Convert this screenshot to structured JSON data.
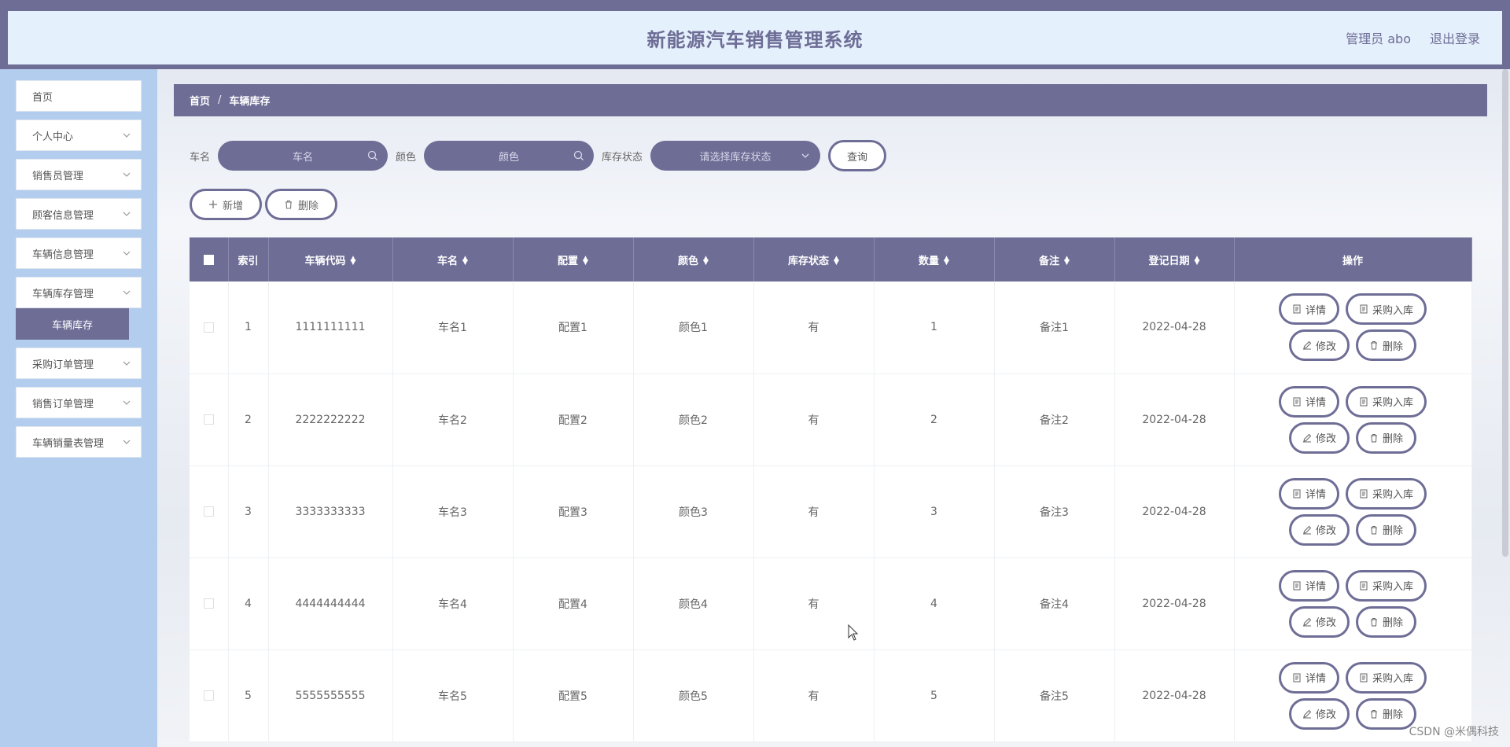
{
  "header": {
    "title": "新能源汽车销售管理系统",
    "user": "管理员 abo",
    "logout": "退出登录"
  },
  "sidebar": {
    "items": [
      {
        "label": "首页",
        "chevron": false
      },
      {
        "label": "个人中心",
        "chevron": true
      },
      {
        "label": "销售员管理",
        "chevron": true
      },
      {
        "label": "顾客信息管理",
        "chevron": true
      },
      {
        "label": "车辆信息管理",
        "chevron": true
      },
      {
        "label": "车辆库存管理",
        "chevron": true
      },
      {
        "label": "采购订单管理",
        "chevron": true
      },
      {
        "label": "销售订单管理",
        "chevron": true
      },
      {
        "label": "车辆销量表管理",
        "chevron": true
      }
    ],
    "active_sub": "车辆库存"
  },
  "breadcrumb": {
    "home": "首页",
    "sep": "/",
    "current": "车辆库存"
  },
  "search": {
    "name_label": "车名",
    "name_placeholder": "车名",
    "color_label": "颜色",
    "color_placeholder": "颜色",
    "status_label": "库存状态",
    "status_placeholder": "请选择库存状态",
    "query_button": "查询"
  },
  "actions": {
    "add": "新增",
    "delete": "删除"
  },
  "table": {
    "headers": {
      "index": "索引",
      "code": "车辆代码",
      "name": "车名",
      "config": "配置",
      "color": "颜色",
      "status": "库存状态",
      "qty": "数量",
      "note": "备注",
      "date": "登记日期",
      "ops": "操作"
    },
    "rows": [
      {
        "index": "1",
        "code": "1111111111",
        "name": "车名1",
        "config": "配置1",
        "color": "颜色1",
        "status": "有",
        "qty": "1",
        "note": "备注1",
        "date": "2022-04-28"
      },
      {
        "index": "2",
        "code": "2222222222",
        "name": "车名2",
        "config": "配置2",
        "color": "颜色2",
        "status": "有",
        "qty": "2",
        "note": "备注2",
        "date": "2022-04-28"
      },
      {
        "index": "3",
        "code": "3333333333",
        "name": "车名3",
        "config": "配置3",
        "color": "颜色3",
        "status": "有",
        "qty": "3",
        "note": "备注3",
        "date": "2022-04-28"
      },
      {
        "index": "4",
        "code": "4444444444",
        "name": "车名4",
        "config": "配置4",
        "color": "颜色4",
        "status": "有",
        "qty": "4",
        "note": "备注4",
        "date": "2022-04-28"
      },
      {
        "index": "5",
        "code": "5555555555",
        "name": "车名5",
        "config": "配置5",
        "color": "颜色5",
        "status": "有",
        "qty": "5",
        "note": "备注5",
        "date": "2022-04-28"
      }
    ],
    "row_ops": {
      "detail": "详情",
      "purchase": "采购入库",
      "edit": "修改",
      "delete": "删除"
    }
  },
  "watermark": "CSDN @米偶科技",
  "colors": {
    "accent": "#6e6d96",
    "sidebar": "#b3cdee",
    "header_bg": "#e4f0fb"
  }
}
